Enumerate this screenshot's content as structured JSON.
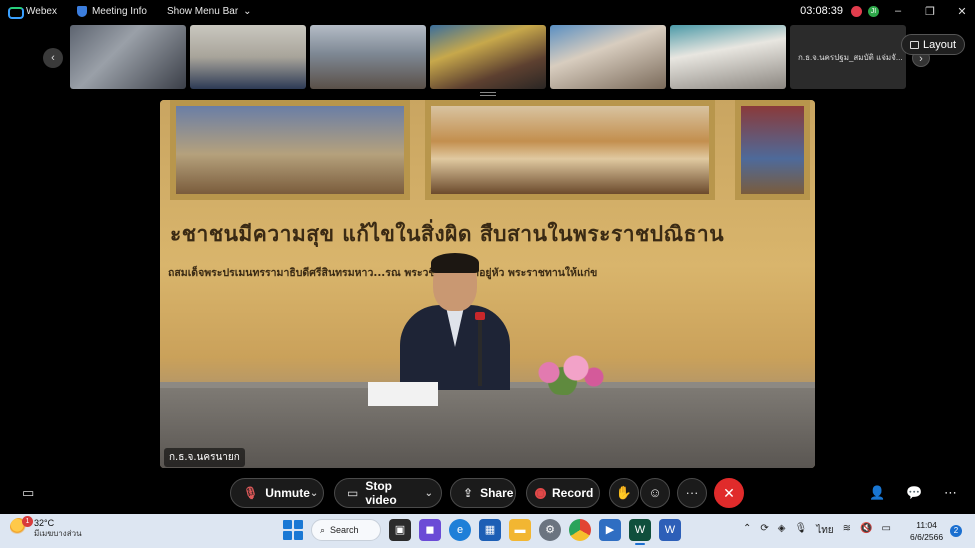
{
  "titlebar": {
    "app_name": "Webex",
    "meeting_info": "Meeting Info",
    "show_menu_bar": "Show Menu Bar",
    "timer": "03:08:39",
    "user_initial": "JI",
    "minimize": "–",
    "restore": "❐",
    "close": "✕"
  },
  "strip": {
    "prev": "‹",
    "next": "›",
    "tile7_name": "ก.ธ.จ.นครปฐม_สมบัติ แจ่มจั...",
    "layout_label": "Layout"
  },
  "video": {
    "banner_main": "ะชาชนมีความสุข แก้ไขในสิ่งผิด สืบสานในพระราชปณิธาน",
    "banner_sub": "ถสมเด็จพระปรเมนทรรามาธิบดีศรีสินทรมหาว...รณ พระวชิรเกล้าเจ้าอยู่หัว พระราชทานให้แก่ข",
    "participant_label": "ก.ธ.จ.นครนายก"
  },
  "controls": {
    "unmute": "Unmute",
    "stop_video": "Stop video",
    "share": "Share",
    "record": "Record",
    "more": "···",
    "end": "✕"
  },
  "taskbar": {
    "weather_badge": "1",
    "temperature": "32°C",
    "weather_desc": "มีเมฆบางส่วน",
    "search": "Search",
    "language": "ไทย",
    "time": "11:04",
    "date": "6/6/2566",
    "notifications": "2"
  },
  "colors": {
    "accent_red": "#e02b2b",
    "taskbar_bg": "#dde6f2",
    "timer_badge_red": "#e23d4d",
    "timer_badge_green": "#2ea84a"
  }
}
